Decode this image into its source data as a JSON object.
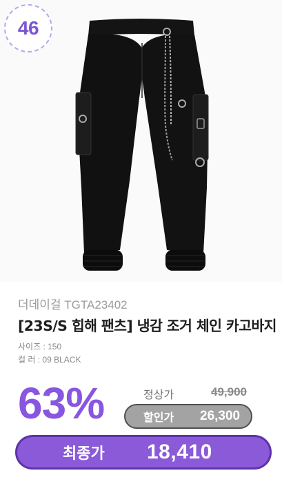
{
  "badge": {
    "rank": "46"
  },
  "product": {
    "brand": "더데이걸 TGTA23402",
    "title": "[23S/S 힙해 팬츠] 냉감 조거 체인 카고바지",
    "size_option": "사이즈 : 150",
    "color_option": "컬    러 : 09 BLACK",
    "image_icon": "black-cargo-jogger-pants"
  },
  "pricing": {
    "discount_rate": "63%",
    "regular_label": "정상가",
    "regular_price": "49,900",
    "sale_label": "할인가",
    "sale_price": "26,300",
    "final_label": "최종가",
    "final_price": "18,410"
  },
  "colors": {
    "accent": "#8856e0",
    "final_pill": "#8a5ad9",
    "sale_pill": "#a3a3a3",
    "badge_border": "#b7a6ea"
  }
}
